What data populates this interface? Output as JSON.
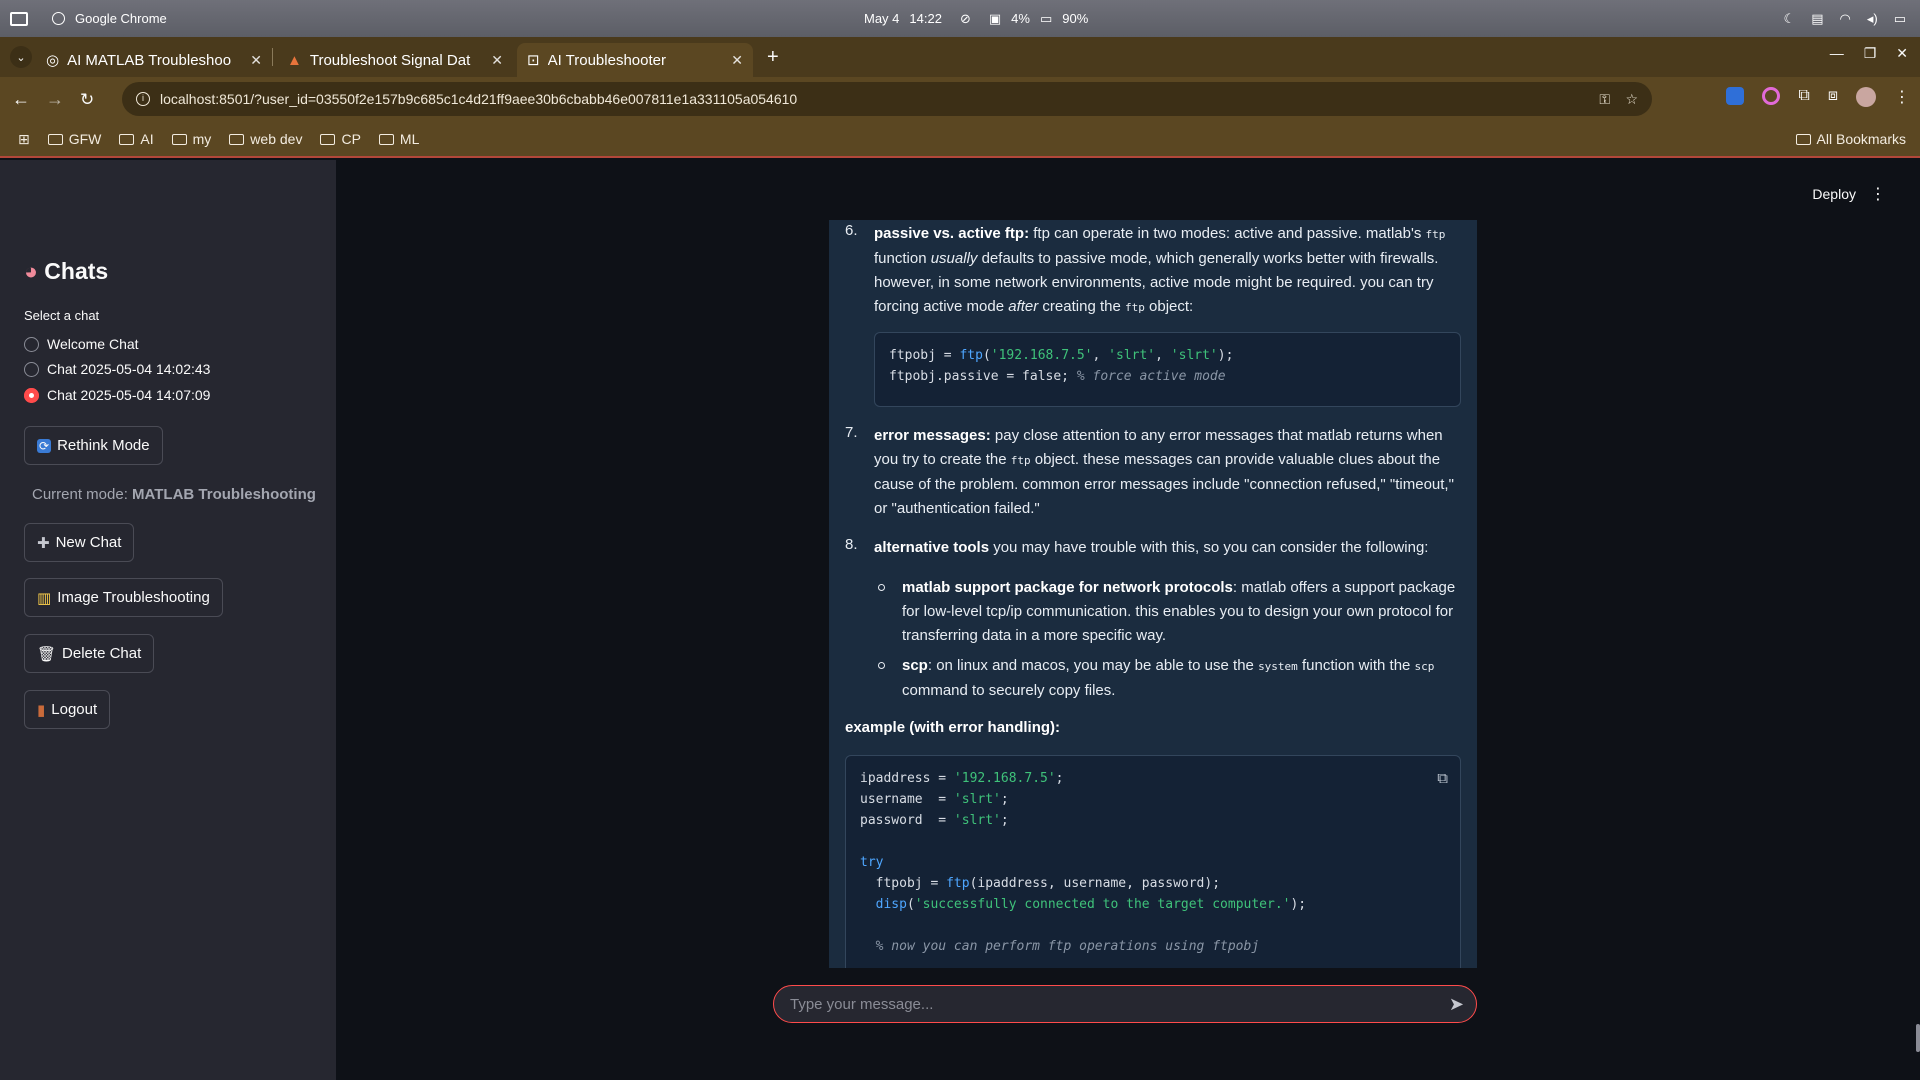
{
  "os": {
    "app_name": "Google Chrome",
    "date": "May 4",
    "time": "14:22",
    "cpu": "4%",
    "battery": "90%"
  },
  "tabs": [
    {
      "title": "AI MATLAB Troubleshoo",
      "active": false
    },
    {
      "title": "Troubleshoot Signal Dat",
      "active": false
    },
    {
      "title": "AI Troubleshooter",
      "active": true
    }
  ],
  "toolbar": {
    "url": "localhost:8501/?user_id=03550f2e157b9c685c1c4d21ff9aee30b6cbabb46e007811e1a331105a054610"
  },
  "bookmarks": {
    "items": [
      "GFW",
      "AI",
      "my",
      "web dev",
      "CP",
      "ML"
    ],
    "all_label": "All Bookmarks"
  },
  "sidebar": {
    "title": "Chats",
    "select_label": "Select a chat",
    "chats": [
      {
        "label": "Welcome Chat",
        "selected": false
      },
      {
        "label": "Chat 2025-05-04 14:02:43",
        "selected": false
      },
      {
        "label": "Chat 2025-05-04 14:07:09",
        "selected": true
      }
    ],
    "rethink_label": "Rethink Mode",
    "mode_prefix": "Current mode: ",
    "mode_value": "MATLAB Troubleshooting",
    "new_chat_label": "New Chat",
    "image_label": "Image Troubleshooting",
    "delete_label": "Delete Chat",
    "logout_label": "Logout"
  },
  "header": {
    "deploy_label": "Deploy"
  },
  "message": {
    "item6_num": "6.",
    "item6_bold": "passive vs. active ftp:",
    "item6_text_a": " ftp can operate in two modes: active and passive. matlab's ",
    "item6_code_a": "ftp",
    "item6_text_b": " function ",
    "item6_em_a": "usually",
    "item6_text_c": " defaults to passive mode, which generally works better with firewalls. however, in some network environments, active mode might be required. you can try forcing active mode ",
    "item6_em_b": "after",
    "item6_text_d": " creating the ",
    "item6_code_b": "ftp",
    "item6_text_e": " object:",
    "code1_line1_a": "ftpobj = ",
    "code1_line1_fn": "ftp",
    "code1_line1_b": "(",
    "code1_line1_s1": "'192.168.7.5'",
    "code1_line1_c": ", ",
    "code1_line1_s2": "'slrt'",
    "code1_line1_d": ", ",
    "code1_line1_s3": "'slrt'",
    "code1_line1_e": ");",
    "code1_line2_a": "ftpobj.passive = false; ",
    "code1_line2_cm": "% force active mode",
    "item7_num": "7.",
    "item7_bold": "error messages:",
    "item7_text_a": " pay close attention to any error messages that matlab returns when you try to create the ",
    "item7_code": "ftp",
    "item7_text_b": " object. these messages can provide valuable clues about the cause of the problem. common error messages include \"connection refused,\" \"timeout,\" or \"authentication failed.\"",
    "item8_num": "8.",
    "item8_bold": "alternative tools",
    "item8_text": " you may have trouble with this, so you can consider the following:",
    "sub1_bold": "matlab support package for network protocols",
    "sub1_text": ": matlab offers a support package for low-level tcp/ip communication. this enables you to design your own protocol for transferring data in a more specific way.",
    "sub2_bold": "scp",
    "sub2_text_a": ": on linux and macos, you may be able to use the ",
    "sub2_code_a": "system",
    "sub2_text_b": " function with the ",
    "sub2_code_b": "scp",
    "sub2_text_c": " command to securely copy files.",
    "example_heading": "example (with error handling):",
    "code2": {
      "l1_a": "ipaddress = ",
      "l1_s": "'192.168.7.5'",
      "l1_b": ";",
      "l2_a": "username  = ",
      "l2_s": "'slrt'",
      "l2_b": ";",
      "l3_a": "password  = ",
      "l3_s": "'slrt'",
      "l3_b": ";",
      "l5_kw": "try",
      "l6_a": "  ftpobj = ",
      "l6_fn": "ftp",
      "l6_b": "(ipaddress, username, password);",
      "l7_fn": "  disp",
      "l7_b": "(",
      "l7_s": "'successfully connected to the target computer.'",
      "l7_c": ");",
      "l9_cm": "  % now you can perform ftp operations using ftpobj"
    }
  },
  "input": {
    "placeholder": "Type your message..."
  }
}
